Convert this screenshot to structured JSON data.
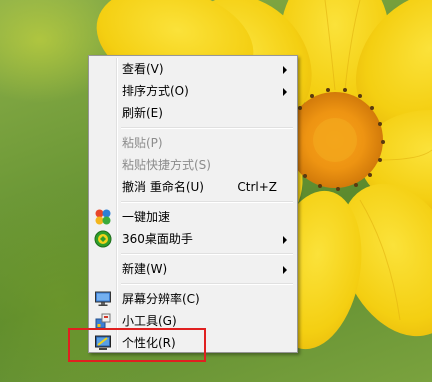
{
  "menu": {
    "items": [
      {
        "label": "查看(V)",
        "submenu": true,
        "disabled": false
      },
      {
        "label": "排序方式(O)",
        "submenu": true,
        "disabled": false
      },
      {
        "label": "刷新(E)",
        "submenu": false,
        "disabled": false
      },
      {
        "label": "粘贴(P)",
        "submenu": false,
        "disabled": true
      },
      {
        "label": "粘贴快捷方式(S)",
        "submenu": false,
        "disabled": true
      },
      {
        "label": "撤消 重命名(U)",
        "shortcut": "Ctrl+Z",
        "submenu": false,
        "disabled": false
      },
      {
        "label": "一键加速",
        "icon": "accelerate-icon",
        "submenu": false,
        "disabled": false
      },
      {
        "label": "360桌面助手",
        "icon": "desktop-assistant-icon",
        "submenu": true,
        "disabled": false
      },
      {
        "label": "新建(W)",
        "submenu": true,
        "disabled": false
      },
      {
        "label": "屏幕分辨率(C)",
        "icon": "monitor-icon",
        "submenu": false,
        "disabled": false
      },
      {
        "label": "小工具(G)",
        "icon": "gadgets-icon",
        "submenu": false,
        "disabled": false
      },
      {
        "label": "个性化(R)",
        "icon": "personalize-icon",
        "submenu": false,
        "disabled": false
      }
    ]
  },
  "colors": {
    "menu_background": "#f1f1f1",
    "menu_border": "#979797",
    "disabled_text": "#8c8c8c",
    "highlight_border": "#e02020",
    "flower_yellow": "#f7d417",
    "flower_center": "#f0a010"
  }
}
